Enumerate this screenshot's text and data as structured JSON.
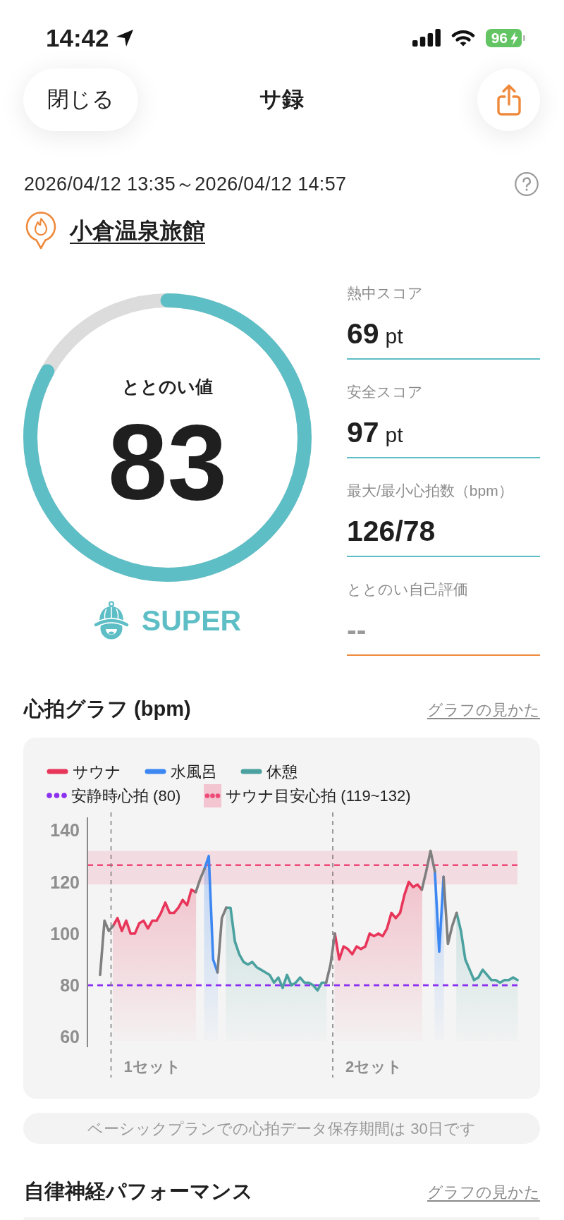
{
  "status_bar": {
    "time": "14:42",
    "battery": "96"
  },
  "header": {
    "close_label": "閉じる",
    "title": "サ録"
  },
  "session": {
    "date_range": "2026/04/12 13:35～2026/04/12 14:57",
    "venue": "小倉温泉旅館"
  },
  "gauge": {
    "label": "ととのい値",
    "value": "83",
    "level": 0.83,
    "rating": "SUPER"
  },
  "metrics": [
    {
      "label": "熱中スコア",
      "value": "69",
      "unit": "pt",
      "kind": "score"
    },
    {
      "label": "安全スコア",
      "value": "97",
      "unit": "pt",
      "kind": "score"
    },
    {
      "label": "最大/最小心拍数（bpm）",
      "value": "126/78",
      "kind": "score"
    },
    {
      "label": "ととのい自己評価",
      "value": "--",
      "kind": "empty"
    }
  ],
  "heart_rate": {
    "title": "心拍グラフ (bpm)",
    "help_link": "グラフの見かた",
    "chart_data": {
      "type": "area",
      "ylim": [
        56,
        145
      ],
      "yticks": [
        60,
        80,
        100,
        120,
        140
      ],
      "categories": [
        null,
        null,
        null,
        null,
        null,
        null,
        null,
        null,
        null,
        null,
        null,
        null,
        "1セット",
        null,
        null,
        null,
        null,
        null,
        null,
        null,
        null,
        null,
        null,
        null,
        null,
        null,
        null,
        null,
        null,
        null,
        null,
        null,
        null,
        null,
        null,
        null,
        null,
        null,
        null,
        null,
        null,
        null,
        null,
        null,
        null,
        null,
        null,
        null,
        null,
        null,
        null,
        null,
        null,
        null,
        null,
        null,
        null,
        null,
        null,
        null,
        null,
        null,
        null,
        "2セット",
        null,
        null,
        null,
        null,
        null,
        null,
        null,
        null,
        null,
        null,
        null,
        null,
        null,
        null,
        null,
        null,
        null,
        null,
        null,
        null,
        null,
        null,
        null,
        null,
        null,
        null,
        null,
        null,
        null,
        null,
        null,
        null,
        null
      ],
      "series": [
        {
          "name": "サウナ",
          "color": "#e8365a",
          "values": [
            null,
            null,
            null,
            103,
            106,
            101,
            105,
            100,
            100,
            104,
            105,
            102,
            105,
            105,
            108,
            112,
            108,
            108,
            110,
            113,
            111,
            117,
            116,
            null,
            null,
            null,
            null,
            null,
            null,
            null,
            null,
            null,
            null,
            null,
            null,
            null,
            null,
            null,
            null,
            null,
            null,
            null,
            null,
            null,
            null,
            null,
            null,
            null,
            null,
            null,
            null,
            null,
            null,
            null,
            100,
            90,
            95,
            94,
            92,
            95,
            94,
            95,
            100,
            99,
            100,
            99,
            102,
            108,
            106,
            108,
            115,
            120,
            118,
            119,
            117,
            null,
            null,
            null,
            null,
            null,
            null,
            null,
            null,
            null,
            null,
            null,
            null,
            null,
            null,
            null,
            null,
            null,
            null,
            null,
            null,
            null,
            null
          ]
        },
        {
          "name": "水風呂",
          "color": "#3c87f2",
          "values": [
            null,
            null,
            null,
            null,
            null,
            null,
            null,
            null,
            null,
            null,
            null,
            null,
            null,
            null,
            null,
            null,
            null,
            null,
            null,
            null,
            null,
            null,
            null,
            null,
            125,
            130,
            90,
            85,
            null,
            null,
            null,
            null,
            null,
            null,
            null,
            null,
            null,
            null,
            null,
            null,
            null,
            null,
            null,
            null,
            null,
            null,
            null,
            null,
            null,
            null,
            null,
            null,
            null,
            null,
            null,
            null,
            null,
            null,
            null,
            null,
            null,
            null,
            null,
            null,
            null,
            null,
            null,
            null,
            null,
            null,
            null,
            null,
            null,
            null,
            null,
            null,
            null,
            124,
            93,
            122,
            null,
            null,
            null,
            null,
            null,
            null,
            null,
            null,
            null,
            null,
            null,
            null,
            null,
            null,
            null,
            null,
            null
          ]
        },
        {
          "name": "休憩",
          "color": "#4aa19f",
          "values": [
            null,
            null,
            null,
            null,
            null,
            null,
            null,
            null,
            null,
            null,
            null,
            null,
            null,
            null,
            null,
            null,
            null,
            null,
            null,
            null,
            null,
            null,
            null,
            null,
            null,
            null,
            null,
            null,
            null,
            110,
            110,
            97,
            92,
            89,
            88,
            89,
            87,
            86,
            85,
            84,
            81,
            83,
            79,
            84,
            80,
            81,
            83,
            81,
            81,
            80,
            78,
            81,
            81,
            null,
            null,
            null,
            null,
            null,
            null,
            null,
            null,
            null,
            null,
            null,
            null,
            null,
            null,
            null,
            null,
            null,
            null,
            null,
            null,
            null,
            null,
            null,
            null,
            null,
            null,
            null,
            null,
            null,
            108,
            101,
            90,
            86,
            82,
            83,
            86,
            84,
            82,
            82,
            81,
            82,
            82,
            83,
            82
          ]
        },
        {
          "type": "line",
          "color": "#7f7f7f",
          "values": [
            84,
            105,
            101,
            103,
            null,
            null,
            null,
            null,
            null,
            null,
            null,
            null,
            null,
            null,
            null,
            null,
            null,
            null,
            null,
            null,
            null,
            null,
            116,
            121,
            125,
            null,
            null,
            85,
            106,
            110,
            null,
            null,
            null,
            null,
            null,
            null,
            null,
            null,
            null,
            null,
            null,
            null,
            null,
            null,
            null,
            null,
            null,
            null,
            null,
            null,
            null,
            null,
            81,
            88,
            100,
            null,
            null,
            null,
            null,
            null,
            null,
            null,
            null,
            null,
            null,
            null,
            null,
            null,
            null,
            null,
            null,
            null,
            null,
            null,
            117,
            124,
            132,
            124,
            null,
            122,
            96,
            103,
            108,
            null,
            null,
            null,
            null,
            null,
            null,
            null,
            null,
            null,
            null,
            null,
            null,
            null,
            null
          ]
        }
      ],
      "ref_lines": [
        {
          "axis": "y",
          "value": 80,
          "label": "安静時心拍 (80)",
          "color": "#8b2ff0"
        },
        {
          "axis": "y",
          "value": 126.5,
          "color": "#ee4a78"
        }
      ],
      "bands": [
        {
          "axis": "y",
          "from": 119,
          "to": 132,
          "label": "サウナ目安心拍 (119~132)",
          "color": "#ee4a78"
        }
      ]
    }
  },
  "note": "ベーシックプランでの心拍データ保存期間は 30日です",
  "autonomic": {
    "title": "自律神経パフォーマンス",
    "help_link": "グラフの見かた"
  }
}
